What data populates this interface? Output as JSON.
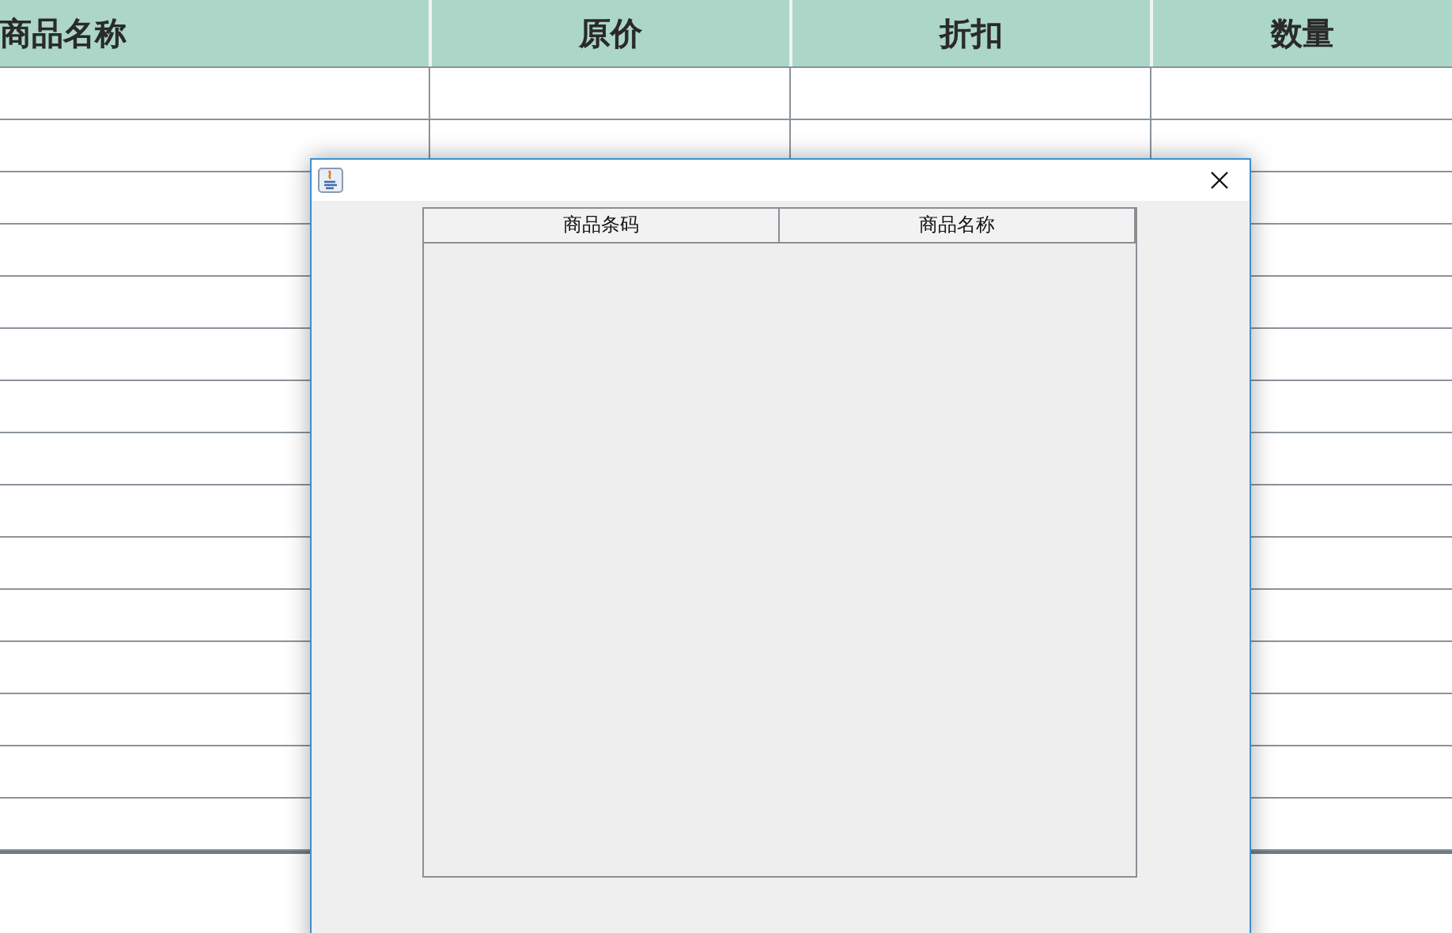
{
  "table": {
    "columns": [
      "商品名称",
      "原价",
      "折扣",
      "数量"
    ]
  },
  "dialog": {
    "table": {
      "columns": [
        "商品条码",
        "商品名称"
      ]
    }
  }
}
